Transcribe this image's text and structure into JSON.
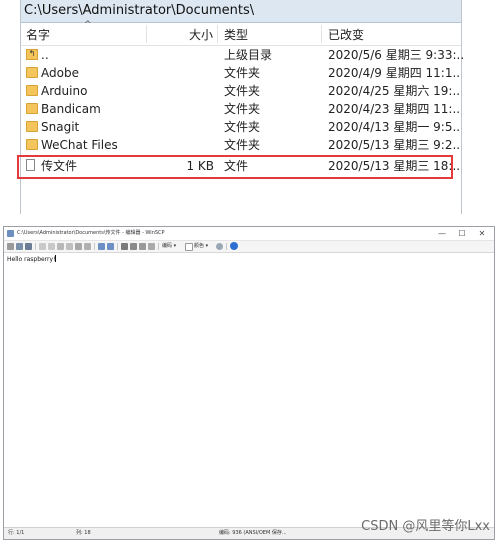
{
  "explorer": {
    "path": "C:\\Users\\Administrator\\Documents\\",
    "columns": {
      "name": "名字",
      "size": "大小",
      "type": "类型",
      "changed": "已改变"
    },
    "rows": [
      {
        "name": "..",
        "size": "",
        "type": "上级目录",
        "changed": "2020/5/6 星期三 9:33:.."
      },
      {
        "name": "Adobe",
        "size": "",
        "type": "文件夹",
        "changed": "2020/4/9 星期四 11:1.."
      },
      {
        "name": "Arduino",
        "size": "",
        "type": "文件夹",
        "changed": "2020/4/25 星期六 19:.."
      },
      {
        "name": "Bandicam",
        "size": "",
        "type": "文件夹",
        "changed": "2020/4/23 星期四 11:.."
      },
      {
        "name": "Snagit",
        "size": "",
        "type": "文件夹",
        "changed": "2020/4/13 星期一 9:5.."
      },
      {
        "name": "WeChat Files",
        "size": "",
        "type": "文件夹",
        "changed": "2020/5/13 星期三 9:2.."
      },
      {
        "name": "传文件",
        "size": "1 KB",
        "type": "文件",
        "changed": "2020/5/13 星期三 18:.."
      }
    ]
  },
  "editor": {
    "title": "C:\\Users\\Administrator\\Documents\\传文件 - 编辑器 - WinSCP",
    "window_controls": {
      "minimize": "—",
      "maximize": "☐",
      "close": "✕"
    },
    "toolbar": {
      "encoding_label": "编码 ▾",
      "color_label": "颜色 ▾"
    },
    "content": "Hello raspberry!",
    "status": {
      "line": "行: 1/1",
      "column": "列: 18",
      "encoding": "编码: 936  (ANSI/OEM  保存..."
    }
  },
  "watermark": "CSDN @风里等你Lxx",
  "colors": {
    "highlight": "#e23b3b",
    "folder": "#f4c55b",
    "path_bar": "#dde7f2"
  }
}
